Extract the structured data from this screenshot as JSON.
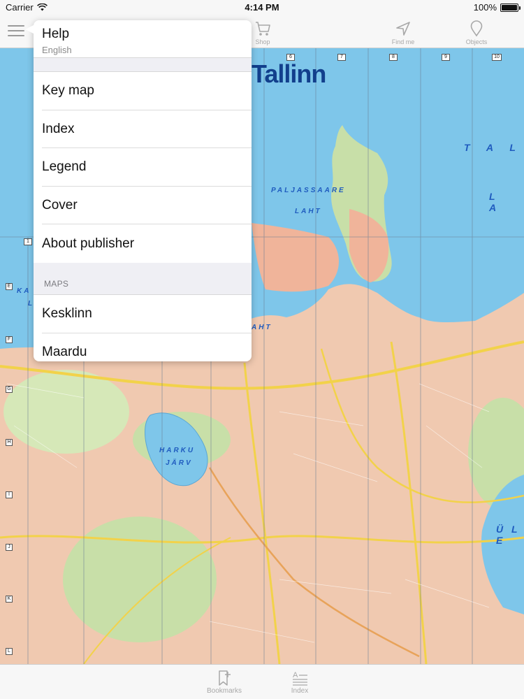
{
  "status_bar": {
    "carrier": "Carrier",
    "time": "4:14 PM",
    "battery": "100%",
    "battery_level": 1.0
  },
  "nav": {
    "menu_icon": "hamburger-icon",
    "items": [
      {
        "label": "Shop",
        "icon": "cart-icon"
      },
      {
        "label": "Find me",
        "icon": "location-arrow-icon"
      },
      {
        "label": "Objects",
        "icon": "pin-icon"
      }
    ]
  },
  "menu": {
    "header": {
      "title": "Help",
      "subtitle": "English"
    },
    "items": [
      {
        "label": "Key map"
      },
      {
        "label": "Index"
      },
      {
        "label": "Legend"
      },
      {
        "label": "Cover"
      },
      {
        "label": "About publisher"
      }
    ],
    "maps_section": {
      "header": "MAPS",
      "items": [
        {
          "label": "Kesklinn"
        },
        {
          "label": "Maardu"
        }
      ]
    }
  },
  "map": {
    "title": "Tallinn",
    "labels": [
      {
        "text": "PALJASSAARE"
      },
      {
        "text": "LAHT"
      },
      {
        "text": "AHT"
      },
      {
        "text": "HARKU"
      },
      {
        "text": "JÄRV"
      },
      {
        "text": "T A L"
      },
      {
        "text": "L A"
      },
      {
        "text": "Ü L E"
      },
      {
        "text": "KA"
      },
      {
        "text": "L"
      }
    ],
    "column_numbers": [
      "1",
      "6",
      "7",
      "8",
      "9",
      "10"
    ],
    "row_letters": [
      "E",
      "F",
      "G",
      "H",
      "I",
      "J",
      "K",
      "L"
    ],
    "colors": {
      "sea": "#7ec6ea",
      "urban": "#f0b49a",
      "green": "#c8dfa8",
      "road": "#f2d24a"
    }
  },
  "tab_bar": {
    "items": [
      {
        "label": "Bookmarks",
        "icon": "bookmark-add-icon"
      },
      {
        "label": "Index",
        "icon": "index-list-icon"
      }
    ]
  }
}
